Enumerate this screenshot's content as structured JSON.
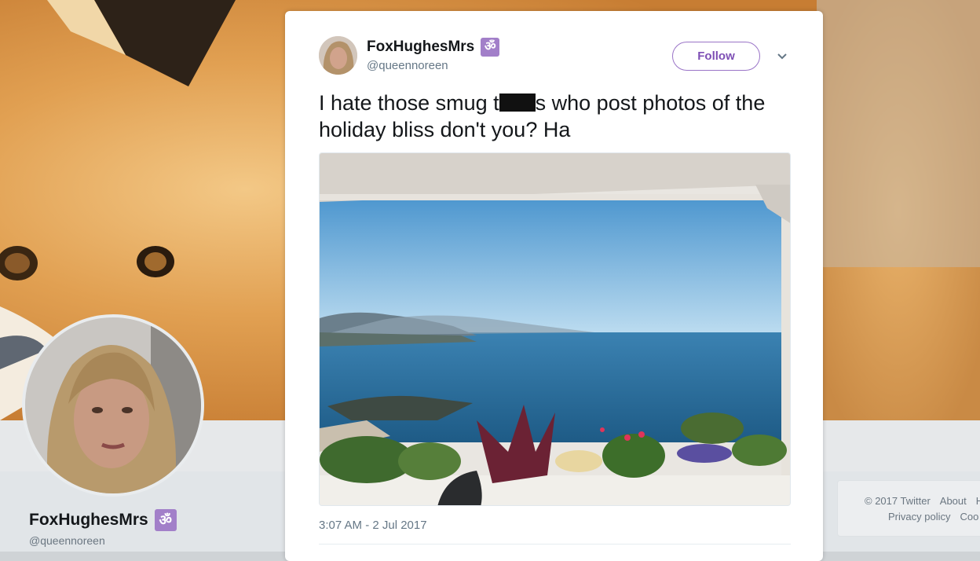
{
  "profile": {
    "display_name": "FoxHughesMrs",
    "badge_icon": "om-symbol",
    "badge_glyph": "ॐ",
    "handle": "@queennoreen"
  },
  "tweet": {
    "display_name": "FoxHughesMrs",
    "badge_glyph": "ॐ",
    "handle": "@queennoreen",
    "follow_label": "Follow",
    "text_before_redaction": "I hate those smug t",
    "text_after_redaction": "s who post photos of the holiday bliss don't you? Ha",
    "timestamp": "3:07 AM - 2 Jul 2017"
  },
  "footer": {
    "copyright": "© 2017 Twitter",
    "about": "About",
    "help_partial": "H",
    "privacy": "Privacy policy",
    "cookies_partial": "Coo"
  },
  "colors": {
    "accent_purple": "#7e4fb5",
    "badge_purple": "#a27fc9",
    "sea_blue": "#2f6f9c",
    "sky_blue": "#79b4df"
  }
}
